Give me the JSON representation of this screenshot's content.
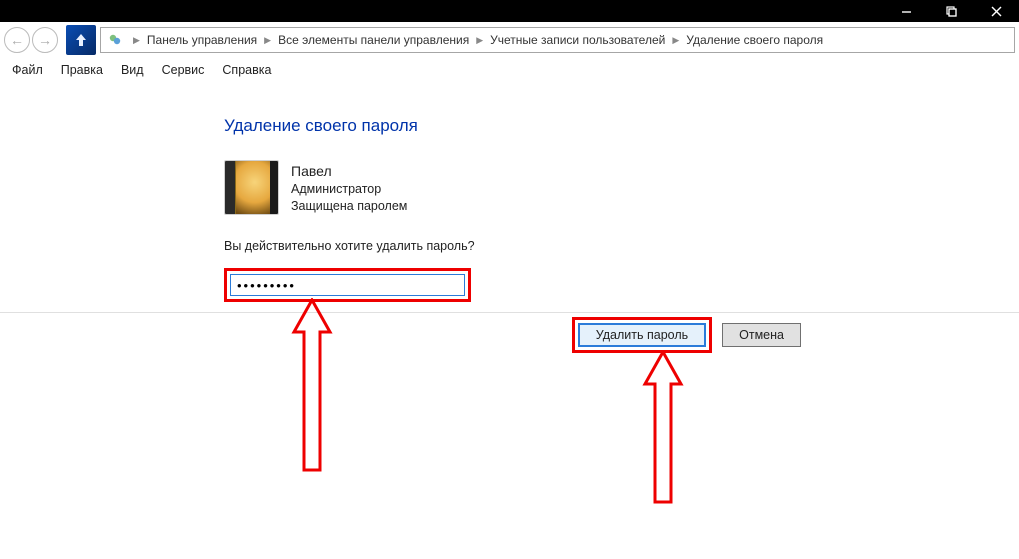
{
  "titlebar": {},
  "address": {
    "items": [
      "Панель управления",
      "Все элементы панели управления",
      "Учетные записи пользователей",
      "Удаление своего пароля"
    ]
  },
  "menu": {
    "file": "Файл",
    "edit": "Правка",
    "view": "Вид",
    "service": "Сервис",
    "help": "Справка"
  },
  "content": {
    "heading": "Удаление своего пароля",
    "user_name": "Павел",
    "user_role": "Администратор",
    "user_status": "Защищена паролем",
    "question": "Вы действительно хотите удалить пароль?",
    "password_value": "•••••••••"
  },
  "buttons": {
    "delete": "Удалить пароль",
    "cancel": "Отмена"
  }
}
